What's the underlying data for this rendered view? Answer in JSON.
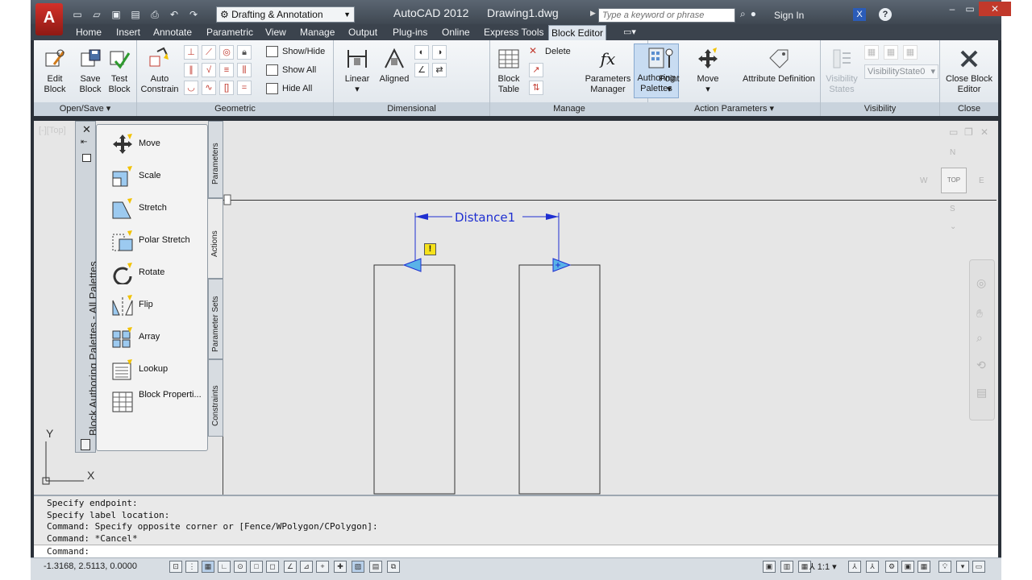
{
  "titlebar": {
    "logo": "A",
    "workspace": "Drafting & Annotation",
    "app": "AutoCAD 2012",
    "document": "Drawing1.dwg",
    "search_placeholder": "Type a keyword or phrase",
    "sign_in": "Sign In"
  },
  "ribbon_tabs": [
    "Home",
    "Insert",
    "Annotate",
    "Parametric",
    "View",
    "Manage",
    "Output",
    "Plug-ins",
    "Online",
    "Express Tools",
    "Block Editor"
  ],
  "ribbon": {
    "open_save": {
      "title": "Open/Save",
      "edit_block": "Edit Block",
      "save_block": "Save Block"
    },
    "test": {
      "test_block": "Test Block"
    },
    "geometric": {
      "title": "Geometric",
      "auto_constrain": "Auto Constrain",
      "show_hide": "Show/Hide",
      "show_all": "Show All",
      "hide_all": "Hide All"
    },
    "dimensional": {
      "title": "Dimensional",
      "linear": "Linear",
      "aligned": "Aligned"
    },
    "manage": {
      "title": "Manage",
      "block_table": "Block Table",
      "delete": "Delete",
      "parameters_manager": "Parameters Manager",
      "authoring_palettes": "Authoring Palettes"
    },
    "action_parameters": {
      "title": "Action Parameters",
      "point": "Point",
      "move": "Move",
      "attribute_definition": "Attribute Definition"
    },
    "visibility": {
      "title": "Visibility",
      "visibility_states": "Visibility States",
      "state_value": "VisibilityState0"
    },
    "close": {
      "title": "Close",
      "close_block_editor": "Close Block Editor"
    }
  },
  "palette": {
    "title": "Block Authoring Palettes - All Palettes",
    "items": [
      "Move",
      "Scale",
      "Stretch",
      "Polar Stretch",
      "Rotate",
      "Flip",
      "Array",
      "Lookup",
      "Block Properti..."
    ],
    "tabs": [
      "Parameters",
      "Actions",
      "Parameter Sets",
      "Constraints"
    ]
  },
  "drawing": {
    "viewport_label": "[-][Top]",
    "dimension_label": "Distance1",
    "warning_mark": "!",
    "view_cube": "TOP",
    "ucs_y": "Y",
    "ucs_x": "X"
  },
  "command": {
    "history": [
      "Specify endpoint:",
      "Specify label location:",
      "Command: Specify opposite corner or [Fence/WPolygon/CPolygon]:",
      "Command: *Cancel*"
    ],
    "prompt": "Command:"
  },
  "status": {
    "coordinates": "-1.3168, 2.5113, 0.0000",
    "annotation_scale": "1:1"
  },
  "colors": {
    "dimension": "#1f2fd1",
    "warning": "#f5e11a",
    "marker": "#5ab3e8",
    "active_button": "#c8dcf2"
  }
}
